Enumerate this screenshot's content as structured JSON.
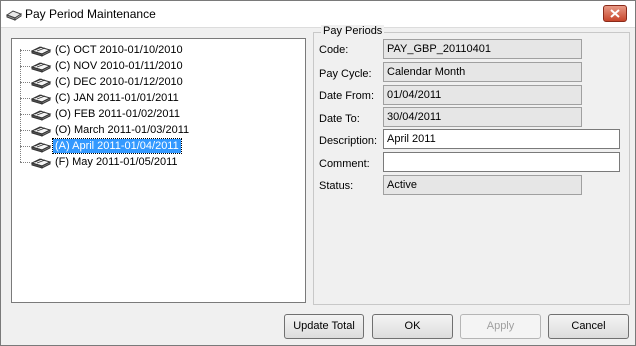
{
  "window": {
    "title": "Pay Period Maintenance",
    "icon": "pay-period-app-icon"
  },
  "tree": {
    "items": [
      {
        "label": "(C) OCT 2010-01/10/2010",
        "selected": false
      },
      {
        "label": "(C) NOV 2010-01/11/2010",
        "selected": false
      },
      {
        "label": "(C) DEC 2010-01/12/2010",
        "selected": false
      },
      {
        "label": "(C) JAN 2011-01/01/2011",
        "selected": false
      },
      {
        "label": "(O) FEB 2011-01/02/2011",
        "selected": false
      },
      {
        "label": "(O) March 2011-01/03/2011",
        "selected": false
      },
      {
        "label": "(A) April 2011-01/04/2011",
        "selected": true
      },
      {
        "label": "(F) May 2011-01/05/2011",
        "selected": false
      }
    ],
    "item_icon": "book-stack-icon",
    "selection_color": "#3399ff"
  },
  "pay_periods": {
    "legend": "Pay Periods",
    "fields": {
      "code": {
        "label": "Code:",
        "value": "PAY_GBP_20110401"
      },
      "pay_cycle": {
        "label": "Pay Cycle:",
        "value": "Calendar Month"
      },
      "date_from": {
        "label": "Date From:",
        "value": "01/04/2011"
      },
      "date_to": {
        "label": "Date To:",
        "value": "30/04/2011"
      },
      "description": {
        "label": "Description:",
        "value": "April 2011"
      },
      "comment": {
        "label": "Comment:",
        "value": ""
      },
      "status": {
        "label": "Status:",
        "value": "Active"
      }
    }
  },
  "buttons": {
    "update_total": "Update Total",
    "ok": "OK",
    "apply": "Apply",
    "cancel": "Cancel"
  }
}
